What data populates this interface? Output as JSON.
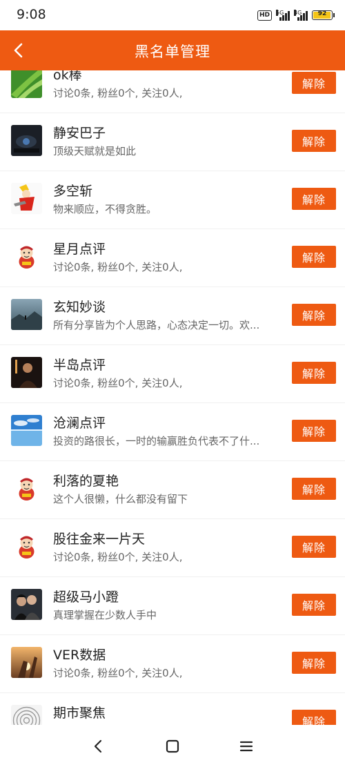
{
  "status_bar": {
    "time": "9:08",
    "hd_label": "HD",
    "net1": "5G",
    "net2": "4G",
    "battery": "92"
  },
  "header": {
    "title": "黑名单管理",
    "back_icon": "chevron-left-icon",
    "accent_color": "#ee5a12"
  },
  "blacklist": {
    "button_label": "解除",
    "items": [
      {
        "name": "ok棒",
        "desc": "讨论0条, 粉丝0个, 关注0人,",
        "avatar": "green-grass"
      },
      {
        "name": "静安巴子",
        "desc": "顶级天赋就是如此",
        "avatar": "dark-cockpit"
      },
      {
        "name": "多空斩",
        "desc": "物来顺应，不得贪胜。",
        "avatar": "anime-warrior"
      },
      {
        "name": "星月点评",
        "desc": "讨论0条, 粉丝0个, 关注0人,",
        "avatar": "default-mascot"
      },
      {
        "name": "玄知妙谈",
        "desc": "所有分享皆为个人思路，心态决定一切。欢...",
        "avatar": "misty-landscape"
      },
      {
        "name": "半岛点评",
        "desc": "讨论0条, 粉丝0个, 关注0人,",
        "avatar": "dark-portrait"
      },
      {
        "name": "沧澜点评",
        "desc": "投资的路很长，一时的输赢胜负代表不了什...",
        "avatar": "blue-sky-water"
      },
      {
        "name": "利落的夏艳",
        "desc": "这个人很懒，什么都没有留下",
        "avatar": "default-mascot"
      },
      {
        "name": "股往金来一片天",
        "desc": "讨论0条, 粉丝0个, 关注0人,",
        "avatar": "default-mascot"
      },
      {
        "name": "超级马小蹬",
        "desc": "真理掌握在少数人手中",
        "avatar": "couple-photo"
      },
      {
        "name": "VER数据",
        "desc": "讨论0条, 粉丝0个, 关注0人,",
        "avatar": "sunset-hand"
      },
      {
        "name": "期市聚焦",
        "desc": "",
        "avatar": "grey-rings"
      }
    ]
  },
  "navbar": {
    "icons": [
      "back-nav-icon",
      "home-nav-icon",
      "menu-nav-icon"
    ]
  }
}
